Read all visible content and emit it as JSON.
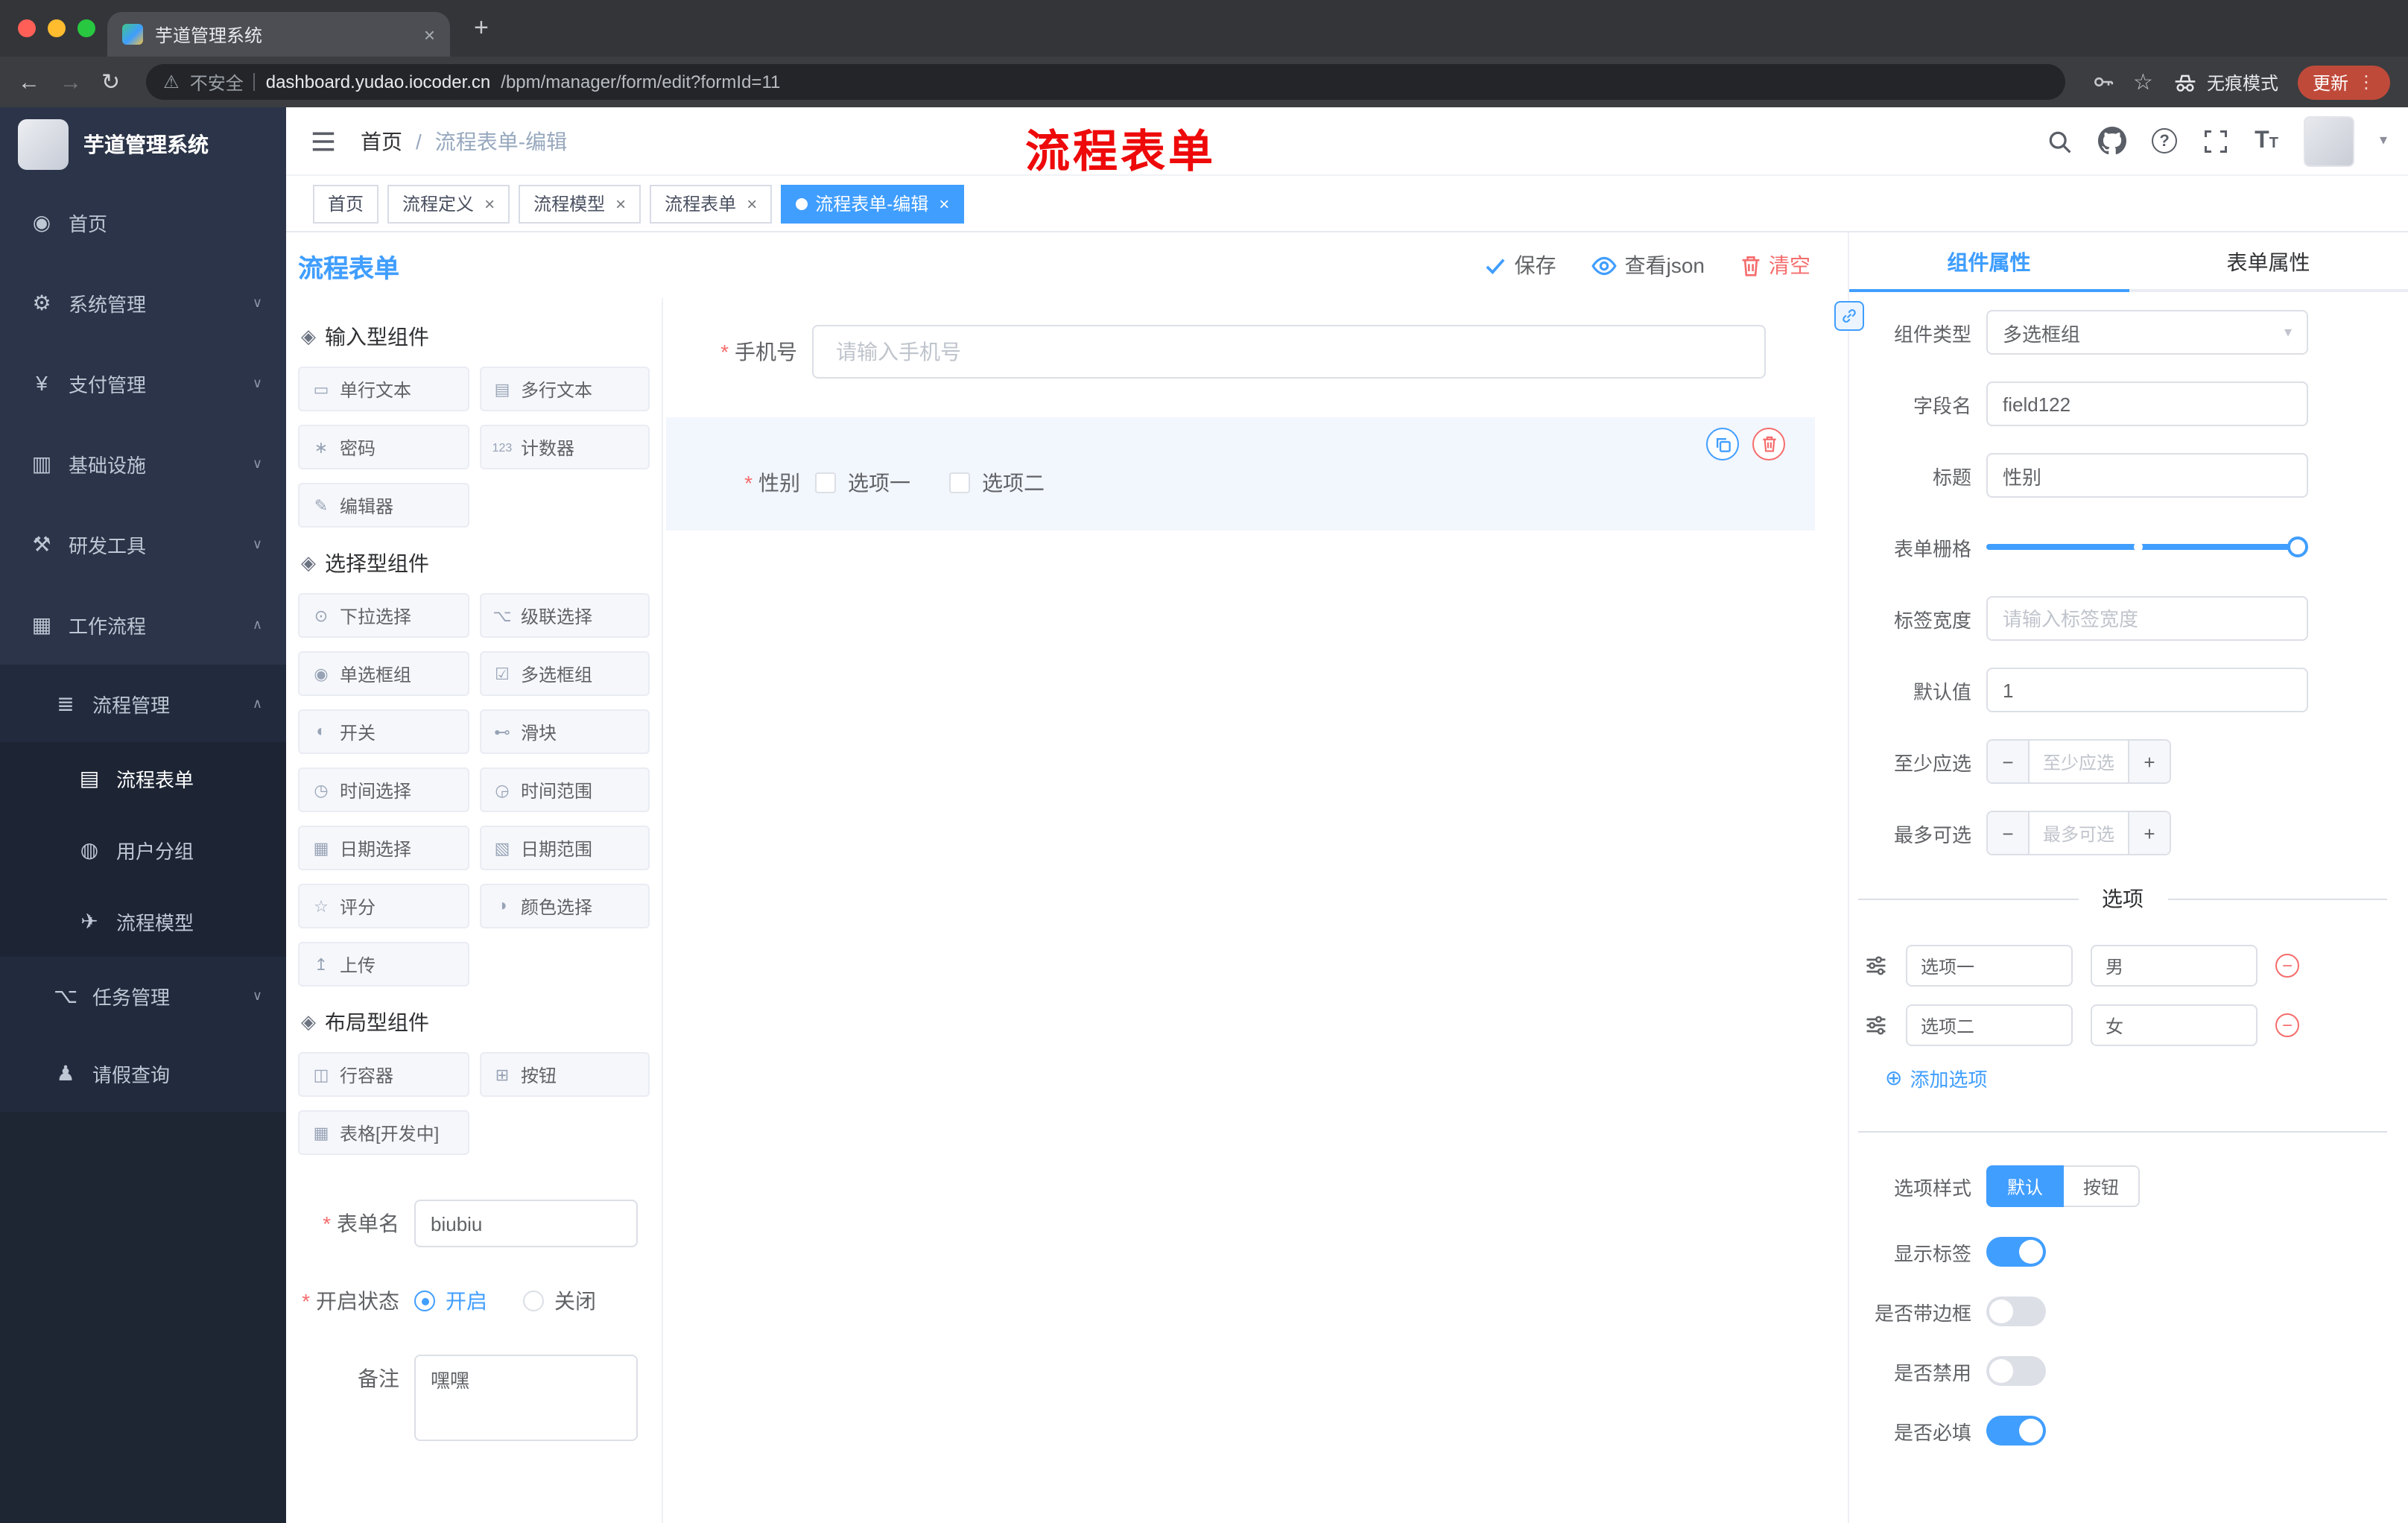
{
  "icons": {
    "close": "×",
    "plus": "+",
    "minus": "−",
    "check": "✓",
    "chevron_down": "∨",
    "chevron_up": "∧",
    "select_caret": "▾",
    "dropdown_caret": "▾",
    "back": "←",
    "forward": "→",
    "reload": "↻",
    "star": "☆",
    "warning": "⚠",
    "dots_vertical": "⋮",
    "slash": "/",
    "question": "?",
    "font_large": "T",
    "font_small": "T",
    "add_circle": "⊕"
  },
  "browser": {
    "tab_title": "芋道管理系统",
    "security_label": "不安全",
    "url_host": "dashboard.yudao.iocoder.cn",
    "url_path": "/bpm/manager/form/edit?formId=11",
    "incognito_label": "无痕模式",
    "update_label": "更新"
  },
  "sidebar": {
    "logo_title": "芋道管理系统",
    "items": [
      {
        "icon": "◉",
        "label": "首页",
        "level": 1
      },
      {
        "icon": "⚙",
        "label": "系统管理",
        "level": 1
      },
      {
        "icon": "¥",
        "label": "支付管理",
        "level": 1
      },
      {
        "icon": "▥",
        "label": "基础设施",
        "level": 1
      },
      {
        "icon": "⚒",
        "label": "研发工具",
        "level": 1
      },
      {
        "icon": "▦",
        "label": "工作流程",
        "level": 1
      },
      {
        "icon": "≣",
        "label": "流程管理",
        "level": 2
      },
      {
        "icon": "▤",
        "label": "流程表单",
        "level": 3,
        "active": true
      },
      {
        "icon": "◍",
        "label": "用户分组",
        "level": 3
      },
      {
        "icon": "✈",
        "label": "流程模型",
        "level": 3
      },
      {
        "icon": "⌥",
        "label": "任务管理",
        "level": 2
      },
      {
        "icon": "♟",
        "label": "请假查询",
        "level": 2
      }
    ]
  },
  "header": {
    "breadcrumb_home": "首页",
    "breadcrumb_current": "流程表单-编辑",
    "annotation": "流程表单"
  },
  "tags": [
    {
      "label": "首页",
      "closable": false,
      "active": false
    },
    {
      "label": "流程定义",
      "closable": true,
      "active": false
    },
    {
      "label": "流程模型",
      "closable": true,
      "active": false
    },
    {
      "label": "流程表单",
      "closable": true,
      "active": false
    },
    {
      "label": "流程表单-编辑",
      "closable": true,
      "active": true
    }
  ],
  "designer": {
    "title": "流程表单",
    "save_label": "保存",
    "view_json_label": "查看json",
    "clear_label": "清空",
    "palette": {
      "sections": [
        {
          "title": "输入型组件",
          "header_icon": "◈",
          "items": [
            {
              "icon": "▭",
              "label": "单行文本"
            },
            {
              "icon": "▤",
              "label": "多行文本"
            },
            {
              "icon": "∗",
              "label": "密码"
            },
            {
              "icon": "123",
              "label": "计数器"
            },
            {
              "icon": "✎",
              "label": "编辑器"
            }
          ]
        },
        {
          "title": "选择型组件",
          "header_icon": "◈",
          "items": [
            {
              "icon": "⊙",
              "label": "下拉选择"
            },
            {
              "icon": "⌥",
              "label": "级联选择"
            },
            {
              "icon": "◉",
              "label": "单选框组"
            },
            {
              "icon": "☑",
              "label": "多选框组"
            },
            {
              "icon": "◐",
              "label": "开关"
            },
            {
              "icon": "⊷",
              "label": "滑块"
            },
            {
              "icon": "◷",
              "label": "时间选择"
            },
            {
              "icon": "◶",
              "label": "时间范围"
            },
            {
              "icon": "▦",
              "label": "日期选择"
            },
            {
              "icon": "▧",
              "label": "日期范围"
            },
            {
              "icon": "☆",
              "label": "评分"
            },
            {
              "icon": "◑",
              "label": "颜色选择"
            },
            {
              "icon": "↥",
              "label": "上传"
            }
          ]
        },
        {
          "title": "布局型组件",
          "header_icon": "◈",
          "items": [
            {
              "icon": "◫",
              "label": "行容器"
            },
            {
              "icon": "⊞",
              "label": "按钮"
            },
            {
              "icon": "▦",
              "label": "表格[开发中]"
            }
          ]
        }
      ]
    },
    "settings": {
      "name_label": "表单名",
      "name_value": "biubiu",
      "status_label": "开启状态",
      "status_on": "开启",
      "status_off": "关闭",
      "remark_label": "备注",
      "remark_value": "嘿嘿"
    },
    "canvas": {
      "phone_label": "手机号",
      "phone_placeholder": "请输入手机号",
      "gender_label": "性别",
      "gender_options": [
        "选项一",
        "选项二"
      ]
    }
  },
  "panel": {
    "tab_component": "组件属性",
    "tab_form": "表单属性",
    "type_label": "组件类型",
    "type_value": "多选框组",
    "field_label": "字段名",
    "field_value": "field122",
    "title_label": "标题",
    "title_value": "性别",
    "grid_label": "表单栅格",
    "width_label": "标签宽度",
    "width_placeholder": "请输入标签宽度",
    "default_label": "默认值",
    "default_value": "1",
    "min_label": "至少应选",
    "min_placeholder": "至少应选",
    "max_label": "最多可选",
    "max_placeholder": "最多可选",
    "options_title": "选项",
    "options": [
      {
        "label": "选项一",
        "value": "男"
      },
      {
        "label": "选项二",
        "value": "女"
      }
    ],
    "add_label": "添加选项",
    "style_label": "选项样式",
    "style_opt_default": "默认",
    "style_opt_button": "按钮",
    "sw_show": "显示标签",
    "sw_border": "是否带边框",
    "sw_disabled": "是否禁用",
    "sw_required": "是否必填"
  },
  "colors": {
    "primary": "#409eff",
    "danger": "#f56c6c",
    "annotation_red": "#ee0a0a",
    "sidebar_bg": "#2b3448",
    "active_tag_bg": "#409eff"
  }
}
